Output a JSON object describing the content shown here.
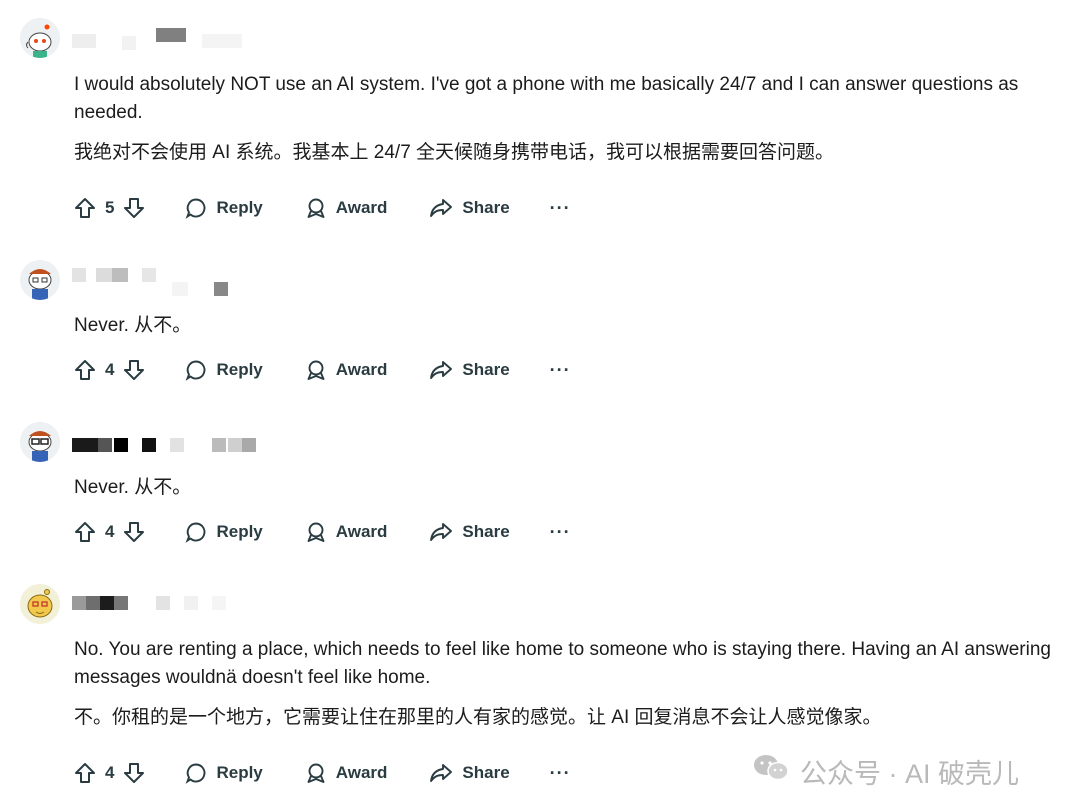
{
  "comments": [
    {
      "avatar": "snoo-avatar-green",
      "text_en": "I would absolutely NOT use an AI system. I've got a phone with me basically 24/7 and I can answer questions as needed.",
      "text_zh": "我绝对不会使用 AI 系统。我基本上 24/7 全天候随身携带电话，我可以根据需要回答问题。",
      "votes": "5"
    },
    {
      "avatar": "snoo-avatar-red-hair",
      "text_en": "Never.  从不。",
      "votes": "4"
    },
    {
      "avatar": "snoo-avatar-glasses",
      "text_en": "Never.  从不。",
      "votes": "4"
    },
    {
      "avatar": "snoo-avatar-yellow",
      "text_en": "No. You are renting a place, which needs to feel like home to someone who is staying there. Having an AI answering messages wouldnä doesn't feel like home.",
      "text_zh": "不。你租的是一个地方，它需要让住在那里的人有家的感觉。让 AI 回复消息不会让人感觉像家。",
      "votes": "4"
    }
  ],
  "actions": {
    "reply": "Reply",
    "award": "Award",
    "share": "Share",
    "more": "···"
  },
  "watermark": {
    "text": "公众号 · AI 破壳儿"
  },
  "colors": {
    "text": "#1c1c1c",
    "action": "#2a3c42",
    "watermark": "#b9b9b9"
  }
}
